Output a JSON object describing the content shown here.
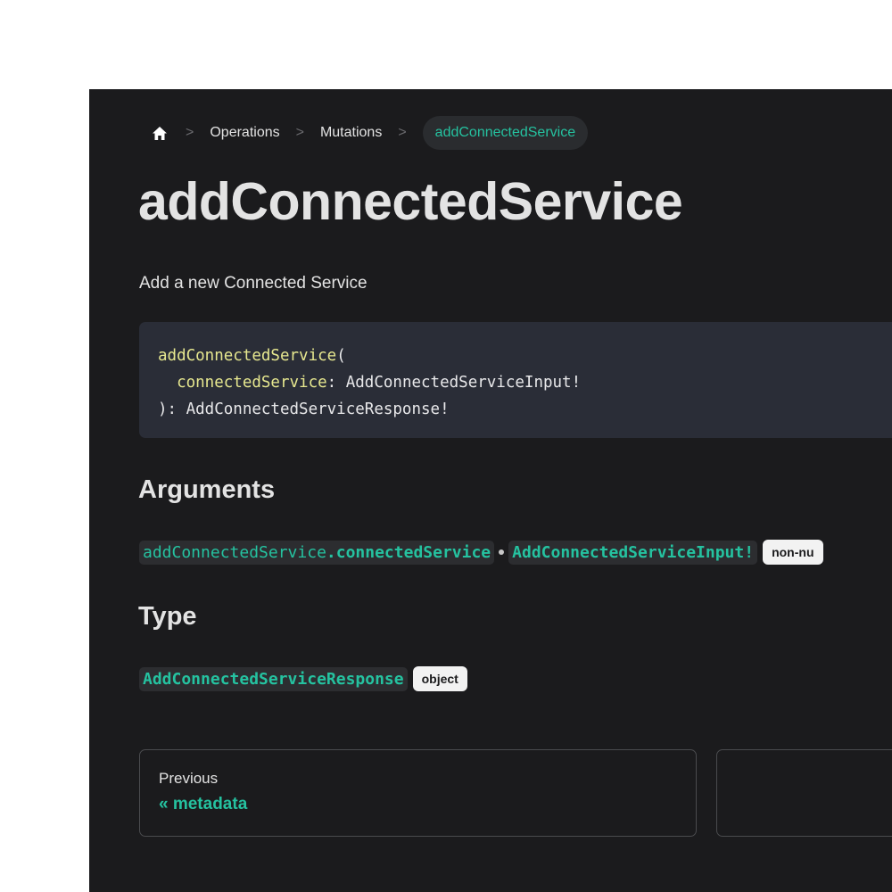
{
  "breadcrumb": {
    "items": [
      "Operations",
      "Mutations"
    ],
    "separator": ">",
    "active": "addConnectedService"
  },
  "page": {
    "title": "addConnectedService",
    "description": "Add a new Connected Service"
  },
  "code": {
    "line1_fn": "addConnectedService",
    "line1_paren": "(",
    "line2_indent": "  ",
    "line2_arg": "connectedService",
    "line2_type": ": AddConnectedServiceInput!",
    "line3": "): AddConnectedServiceResponse!"
  },
  "arguments": {
    "heading": "Arguments",
    "prefix": "addConnectedService",
    "name": ".connectedService",
    "type": "AddConnectedServiceInput!",
    "badge": "non-nu"
  },
  "type_section": {
    "heading": "Type",
    "type": "AddConnectedServiceResponse",
    "badge": "object"
  },
  "pagination": {
    "previous_sublabel": "Previous",
    "previous_label": "« metadata"
  },
  "colors": {
    "background": "#1b1b1d",
    "accent": "#25c2a0",
    "code_bg": "#2a2d37",
    "code_fn": "#e6e78f"
  },
  "icons": {
    "home": "home-icon"
  }
}
